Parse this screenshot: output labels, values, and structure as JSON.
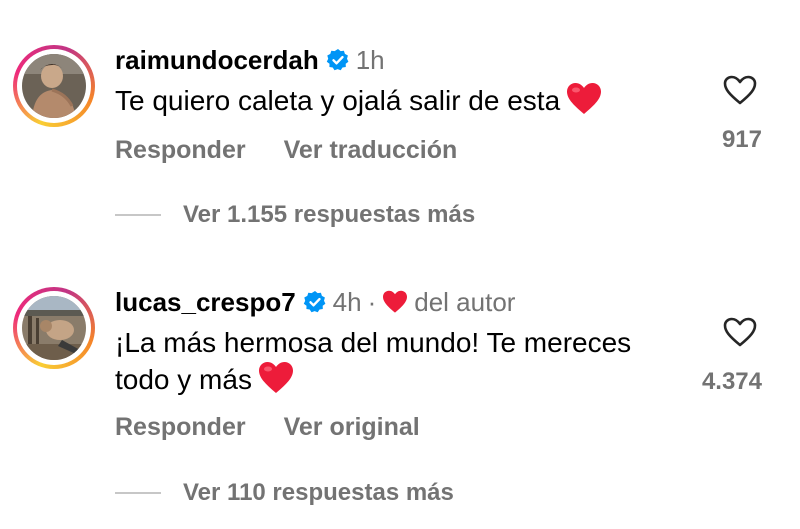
{
  "comments": [
    {
      "username": "raimundocerdah",
      "verified": true,
      "time": "1h",
      "text": "Te quiero caleta y ojalá salir de esta",
      "text_emoji": "red-heart",
      "like_count": "917",
      "actions": {
        "reply": "Responder",
        "translate": "Ver traducción"
      },
      "view_replies": "Ver 1.155 respuestas más"
    },
    {
      "username": "lucas_crespo7",
      "verified": true,
      "time": "4h",
      "separator": "·",
      "author_liked_label": "del autor",
      "text_line1": "¡La más hermosa del mundo! Te mereces",
      "text_line2": "todo y más",
      "text_emoji": "red-heart",
      "like_count": "4.374",
      "actions": {
        "reply": "Responder",
        "original": "Ver original"
      },
      "view_replies": "Ver 110 respuestas más"
    }
  ],
  "colors": {
    "secondary_text": "#737373",
    "verified_blue": "#0095f6",
    "heart_red": "#ed1c3a",
    "divider": "#c7c7c7"
  }
}
